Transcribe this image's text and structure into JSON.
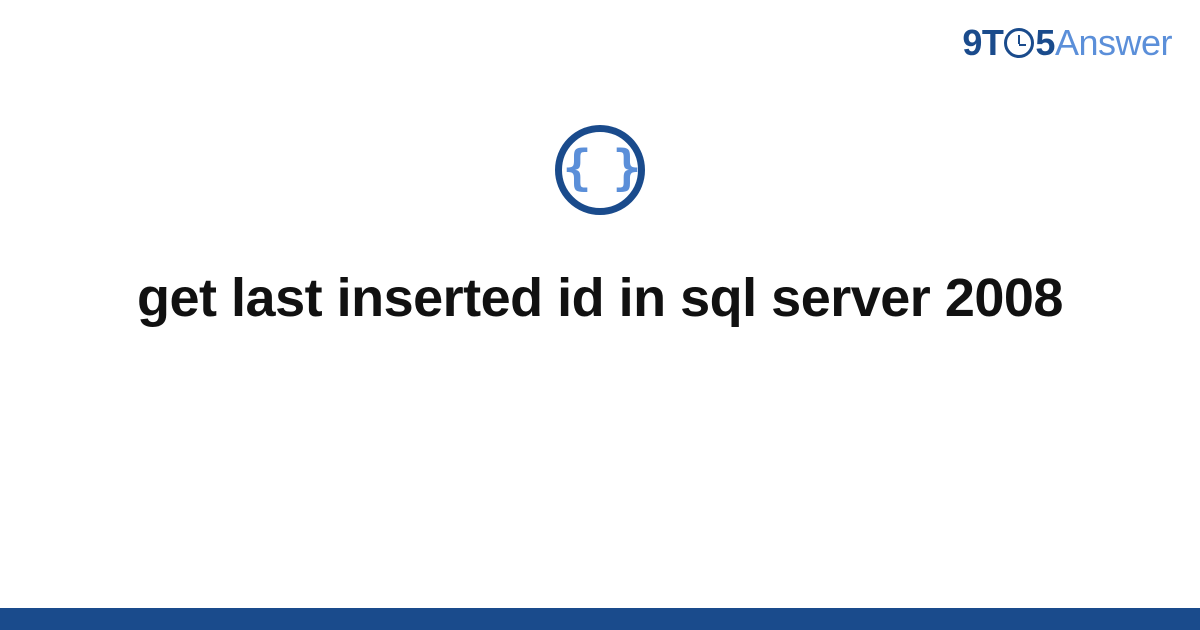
{
  "brand": {
    "part1": "9T",
    "part2": "5",
    "part3": "Answer"
  },
  "icon": {
    "name": "braces-icon",
    "glyph": "{ }"
  },
  "title": "get last inserted id in sql server 2008",
  "colors": {
    "primary": "#1a4b8c",
    "accent": "#5b8fd9",
    "text": "#111111",
    "background": "#ffffff"
  }
}
